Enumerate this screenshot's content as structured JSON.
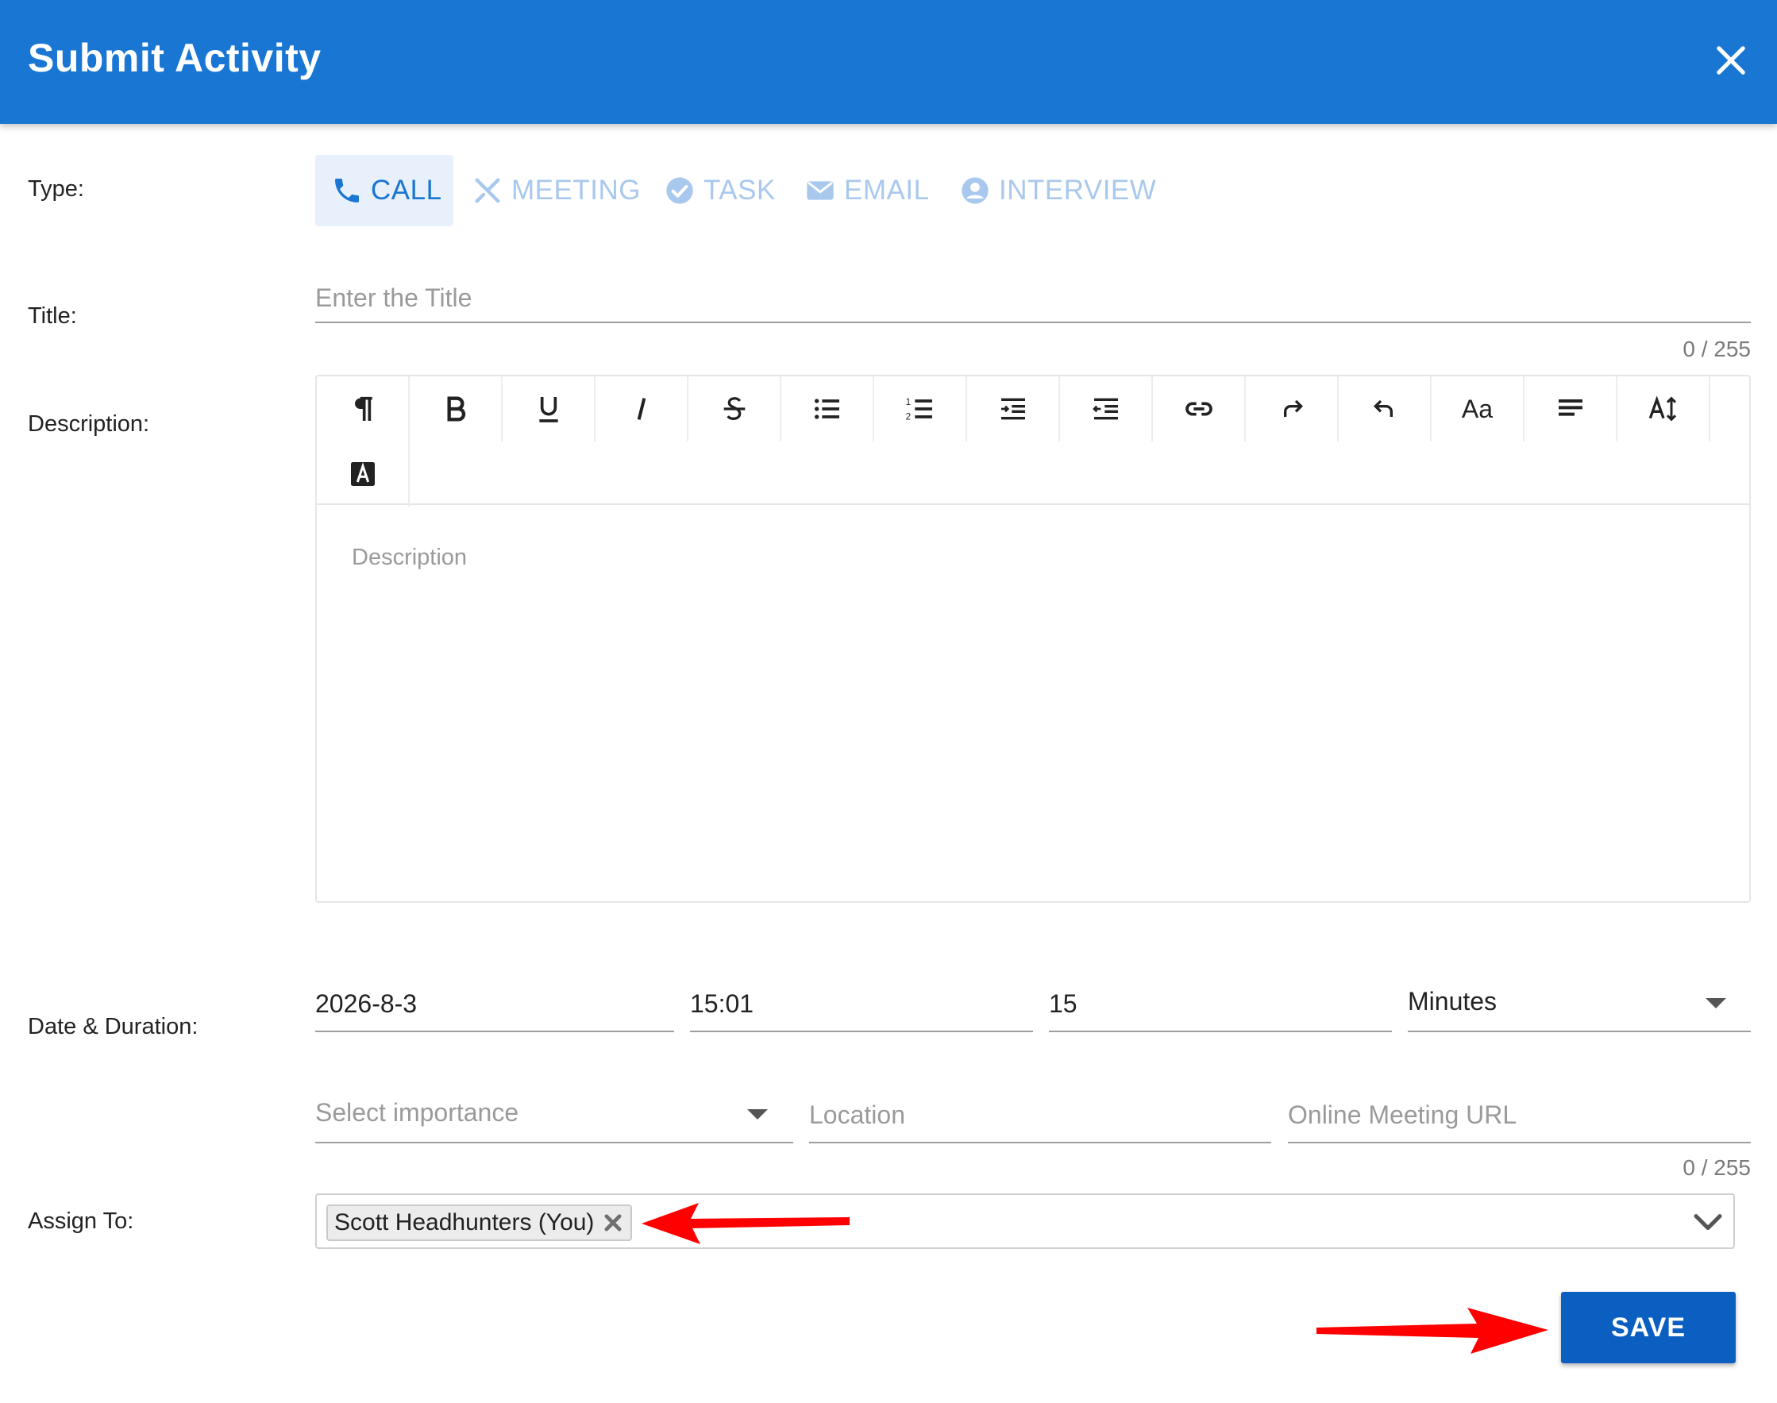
{
  "header": {
    "title": "Submit Activity",
    "close_icon": "close-icon"
  },
  "labels": {
    "type": "Type:",
    "title": "Title:",
    "description": "Description:",
    "date_duration": "Date & Duration:",
    "assign_to": "Assign To:"
  },
  "type_tabs": [
    {
      "label": "CALL",
      "icon": "phone-icon",
      "active": true
    },
    {
      "label": "MEETING",
      "icon": "utensils-icon",
      "active": false
    },
    {
      "label": "TASK",
      "icon": "check-circle-icon",
      "active": false
    },
    {
      "label": "EMAIL",
      "icon": "mail-icon",
      "active": false
    },
    {
      "label": "INTERVIEW",
      "icon": "account-circle-icon",
      "active": false
    }
  ],
  "title_field": {
    "placeholder": "Enter the Title",
    "value": "",
    "counter": "0 / 255"
  },
  "editor": {
    "placeholder": "Description",
    "toolbar": [
      "paragraph-icon",
      "bold-icon",
      "underline-icon",
      "italic-icon",
      "strikethrough-icon",
      "bullet-list-icon",
      "numbered-list-icon",
      "indent-icon",
      "outdent-icon",
      "link-icon",
      "redo-icon",
      "undo-icon",
      "font-size-icon",
      "align-icon",
      "line-height-icon",
      "text-color-icon"
    ],
    "font_size_label": "Aa"
  },
  "date_duration": {
    "date": "2026-8-3",
    "time": "15:01",
    "duration": "15",
    "unit": "Minutes"
  },
  "extra_fields": {
    "importance_placeholder": "Select importance",
    "location_placeholder": "Location",
    "url_placeholder": "Online Meeting URL",
    "counter": "0 / 255"
  },
  "assign": {
    "chip": "Scott Headhunters (You)"
  },
  "save_label": "SAVE",
  "colors": {
    "header": "#1976d2",
    "save": "#0b5fc0",
    "tab_inactive": "#a9c8ee",
    "annotation_arrow": "#ff0000"
  }
}
